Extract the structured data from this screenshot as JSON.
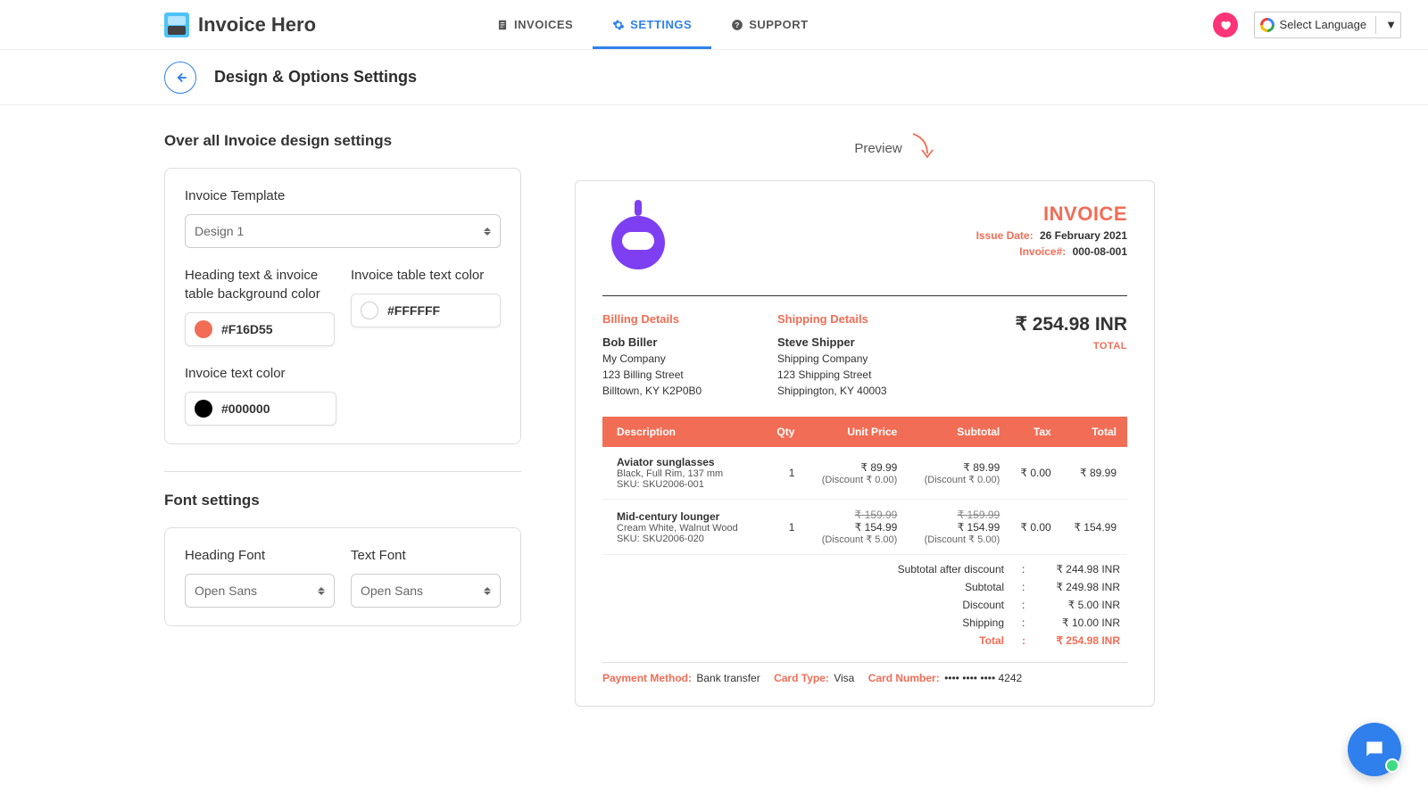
{
  "app_name": "Invoice Hero",
  "nav": {
    "invoices": "INVOICES",
    "settings": "SETTINGS",
    "support": "SUPPORT"
  },
  "lang_selector": "Select Language",
  "page_title": "Design & Options Settings",
  "left": {
    "section1_title": "Over all Invoice design settings",
    "template_label": "Invoice Template",
    "template_value": "Design 1",
    "heading_color_label": "Heading text & invoice table background color",
    "heading_color_value": "#F16D55",
    "table_text_color_label": "Invoice table text color",
    "table_text_color_value": "#FFFFFF",
    "invoice_text_color_label": "Invoice text color",
    "invoice_text_color_value": "#000000",
    "section2_title": "Font settings",
    "heading_font_label": "Heading Font",
    "heading_font_value": "Open Sans",
    "text_font_label": "Text Font",
    "text_font_value": "Open Sans"
  },
  "preview_label": "Preview",
  "invoice": {
    "title": "INVOICE",
    "issue_date_label": "Issue Date:",
    "issue_date": "26 February 2021",
    "number_label": "Invoice#:",
    "number": "000-08-001",
    "billing_title": "Billing Details",
    "billing_name": "Bob Biller",
    "billing_company": "My Company",
    "billing_street": "123 Billing Street",
    "billing_city": "Billtown, KY K2P0B0",
    "shipping_title": "Shipping Details",
    "shipping_name": "Steve Shipper",
    "shipping_company": "Shipping Company",
    "shipping_street": "123 Shipping Street",
    "shipping_city": "Shippington, KY 40003",
    "total_amount": "₹ 254.98 INR",
    "total_label": "TOTAL",
    "columns": {
      "desc": "Description",
      "qty": "Qty",
      "unit": "Unit Price",
      "subtotal": "Subtotal",
      "tax": "Tax",
      "total": "Total"
    },
    "items": [
      {
        "name": "Aviator sunglasses",
        "variant": "Black, Full Rim, 137 mm",
        "sku": "SKU: SKU2006-001",
        "qty": "1",
        "unit": "₹ 89.99",
        "unit_discount": "(Discount ₹ 0.00)",
        "subtotal": "₹ 89.99",
        "subtotal_discount": "(Discount ₹ 0.00)",
        "tax": "₹ 0.00",
        "total": "₹ 89.99"
      },
      {
        "name": "Mid-century lounger",
        "variant": "Cream White, Walnut Wood",
        "sku": "SKU: SKU2006-020",
        "qty": "1",
        "unit_orig": "₹ 159.99",
        "unit": "₹ 154.99",
        "unit_discount": "(Discount ₹ 5.00)",
        "subtotal_orig": "₹ 159.99",
        "subtotal": "₹ 154.99",
        "subtotal_discount": "(Discount ₹ 5.00)",
        "tax": "₹ 0.00",
        "total": "₹ 154.99"
      }
    ],
    "summary": {
      "after_discount_lbl": "Subtotal after discount",
      "after_discount_val": "₹ 244.98 INR",
      "subtotal_lbl": "Subtotal",
      "subtotal_val": "₹ 249.98 INR",
      "discount_lbl": "Discount",
      "discount_val": "₹ 5.00 INR",
      "shipping_lbl": "Shipping",
      "shipping_val": "₹ 10.00 INR",
      "total_lbl": "Total",
      "total_val": "₹ 254.98 INR"
    },
    "payment": {
      "method_lbl": "Payment Method:",
      "method_val": "Bank transfer",
      "card_type_lbl": "Card Type:",
      "card_type_val": "Visa",
      "card_num_lbl": "Card Number:",
      "card_num_val": "•••• •••• •••• 4242"
    }
  }
}
